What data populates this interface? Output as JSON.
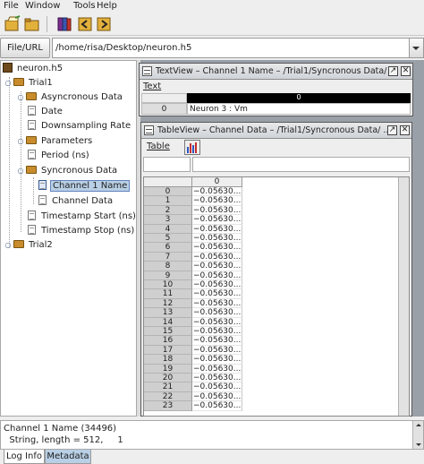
{
  "menubar": {
    "items": [
      {
        "label": "File"
      },
      {
        "label": "Window"
      },
      {
        "label": "Tools"
      },
      {
        "label": "Help"
      }
    ]
  },
  "toolbar": {
    "buttons": [
      {
        "icon": "open-file-icon"
      },
      {
        "icon": "open-folder-icon"
      },
      {
        "icon": "books-icon"
      },
      {
        "icon": "book-left-icon"
      },
      {
        "icon": "book-right-icon"
      }
    ]
  },
  "address": {
    "button_label": "File/URL",
    "path": "/home/risa/Desktop/neuron.h5"
  },
  "tree": {
    "root": "neuron.h5",
    "items": [
      {
        "label": "Trial1",
        "type": "folder"
      },
      {
        "label": "Asyncronous Data",
        "type": "folder"
      },
      {
        "label": "Date",
        "type": "doc"
      },
      {
        "label": "Downsampling Rate",
        "type": "doc"
      },
      {
        "label": "Parameters",
        "type": "folder"
      },
      {
        "label": "Period (ns)",
        "type": "doc"
      },
      {
        "label": "Syncronous Data",
        "type": "folder"
      },
      {
        "label": "Channel 1 Name",
        "type": "doc",
        "selected": true
      },
      {
        "label": "Channel Data",
        "type": "doc"
      },
      {
        "label": "Timestamp Start (ns)",
        "type": "doc"
      },
      {
        "label": "Timestamp Stop (ns)",
        "type": "doc"
      },
      {
        "label": "Trial2",
        "type": "folder"
      }
    ]
  },
  "textview": {
    "title": "TextView  –  Channel 1 Name  –  /Trial1/Syncronous Data/ ...",
    "menu_label": "Text",
    "column_header": "0",
    "rows": [
      {
        "index": "0",
        "value": "Neuron 3 : Vm"
      }
    ]
  },
  "tableview": {
    "title": "TableView  –  Channel Data  –  /Trial1/Syncronous Data/ ...",
    "menu_label": "Table",
    "chart_icon": "chart-icon",
    "column_header": "0",
    "row_labels": [
      "0",
      "1",
      "2",
      "3",
      "4",
      "5",
      "6",
      "7",
      "8",
      "9",
      "10",
      "11",
      "12",
      "13",
      "14",
      "15",
      "16",
      "17",
      "18",
      "19",
      "20",
      "21",
      "22",
      "23"
    ],
    "cell_value": "−0.05630..."
  },
  "info": {
    "line1": "Channel 1 Name (34496)",
    "line2": "  String, length = 512,     1"
  },
  "bottom_tabs": [
    {
      "label": "Log Info"
    },
    {
      "label": "Metadata"
    }
  ],
  "colors": {
    "selection": "#b8cfe5",
    "desktop": "#9aa0a8",
    "folder": "#c88c2c"
  }
}
